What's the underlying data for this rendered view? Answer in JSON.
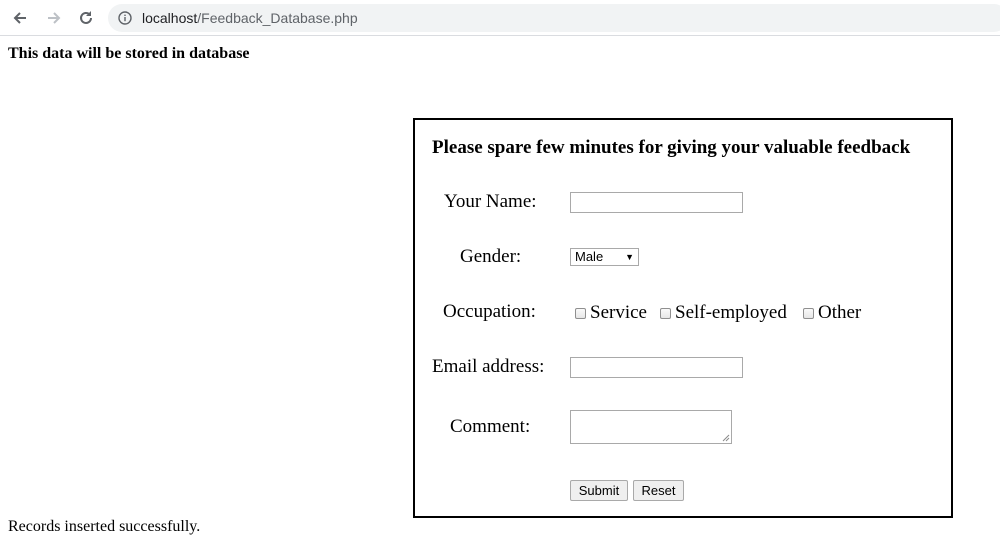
{
  "browser": {
    "url_host": "localhost",
    "url_path": "/Feedback_Database.php"
  },
  "page": {
    "notice": "This data will be stored in database",
    "status": "Records inserted successfully."
  },
  "form": {
    "title": "Please spare few minutes for giving your valuable feedback",
    "name_label": "Your Name:",
    "name_value": "",
    "gender_label": "Gender:",
    "gender_selected": "Male",
    "occupation_label": "Occupation:",
    "occupation_options": [
      "Service",
      "Self-employed",
      "Other"
    ],
    "email_label": "Email address:",
    "email_value": "",
    "comment_label": "Comment:",
    "comment_value": "",
    "submit_label": "Submit",
    "reset_label": "Reset"
  },
  "icons": {
    "back": "arrow-left",
    "forward": "arrow-right",
    "reload": "reload",
    "site_info": "info-circle"
  },
  "colors": {
    "omnibox_bg": "#f1f3f4",
    "button_bg": "#efefef"
  }
}
